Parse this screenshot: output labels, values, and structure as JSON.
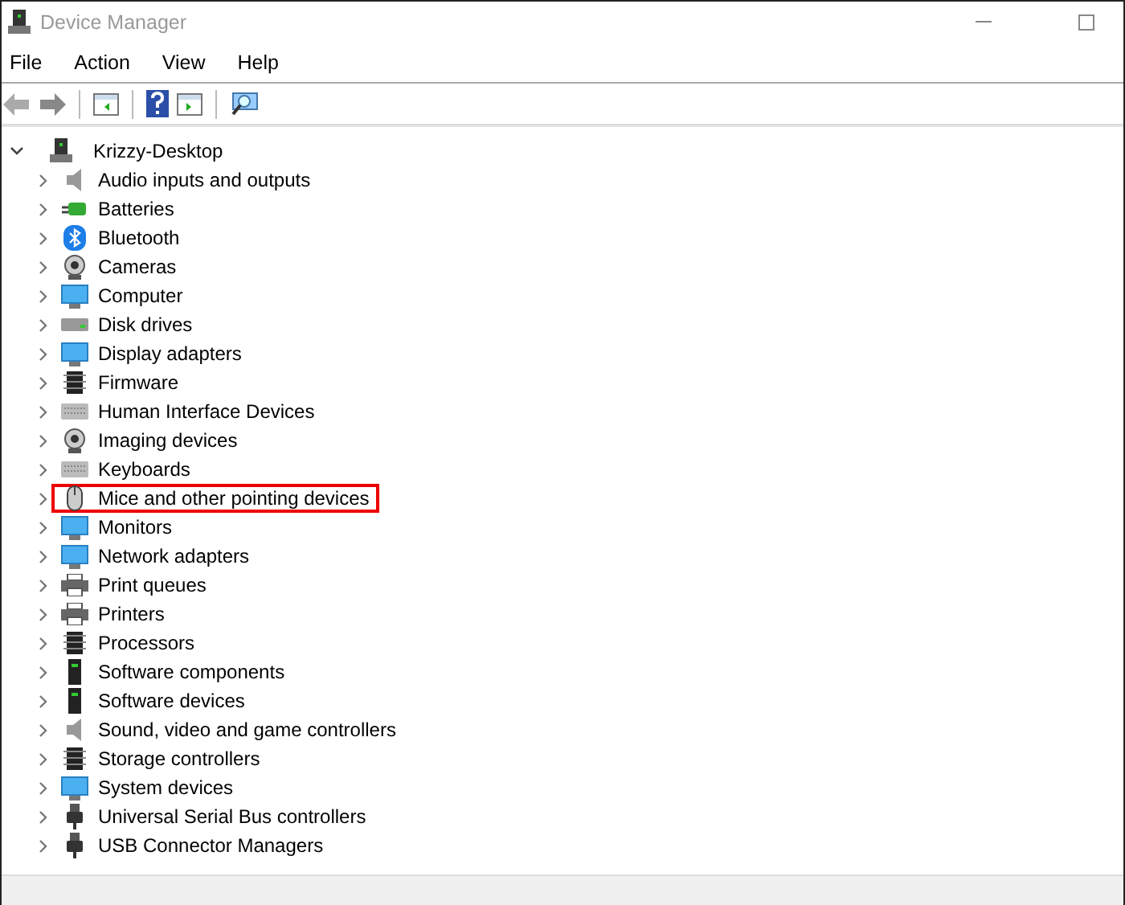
{
  "window": {
    "title": "Device Manager"
  },
  "menu": [
    "File",
    "Action",
    "View",
    "Help"
  ],
  "tree": {
    "label": "Krizzy-Desktop",
    "expanded": true,
    "children": [
      {
        "label": "Audio inputs and outputs",
        "highlighted": false
      },
      {
        "label": "Batteries",
        "highlighted": false
      },
      {
        "label": "Bluetooth",
        "highlighted": false
      },
      {
        "label": "Cameras",
        "highlighted": false
      },
      {
        "label": "Computer",
        "highlighted": false
      },
      {
        "label": "Disk drives",
        "highlighted": false
      },
      {
        "label": "Display adapters",
        "highlighted": false
      },
      {
        "label": "Firmware",
        "highlighted": false
      },
      {
        "label": "Human Interface Devices",
        "highlighted": false
      },
      {
        "label": "Imaging devices",
        "highlighted": false
      },
      {
        "label": "Keyboards",
        "highlighted": false
      },
      {
        "label": "Mice and other pointing devices",
        "highlighted": true
      },
      {
        "label": "Monitors",
        "highlighted": false
      },
      {
        "label": "Network adapters",
        "highlighted": false
      },
      {
        "label": "Print queues",
        "highlighted": false
      },
      {
        "label": "Printers",
        "highlighted": false
      },
      {
        "label": "Processors",
        "highlighted": false
      },
      {
        "label": "Software components",
        "highlighted": false
      },
      {
        "label": "Software devices",
        "highlighted": false
      },
      {
        "label": "Sound, video and game controllers",
        "highlighted": false
      },
      {
        "label": "Storage controllers",
        "highlighted": false
      },
      {
        "label": "System devices",
        "highlighted": false
      },
      {
        "label": "Universal Serial Bus controllers",
        "highlighted": false
      },
      {
        "label": "USB Connector Managers",
        "highlighted": false
      }
    ]
  }
}
